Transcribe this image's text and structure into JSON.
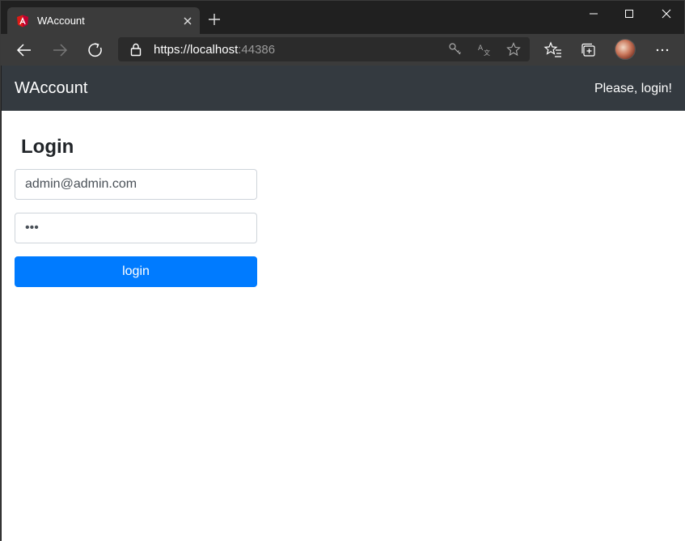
{
  "browser": {
    "tab": {
      "title": "WAccount",
      "favicon": "angular-logo-icon"
    },
    "address": {
      "scheme": "https://",
      "host": "localhost",
      "port": ":44386"
    }
  },
  "app": {
    "brand": "WAccount",
    "nav_message": "Please, login!"
  },
  "login": {
    "title": "Login",
    "email_value": "admin@admin.com",
    "password_value": "abc",
    "button_label": "login"
  },
  "colors": {
    "navbar": "#343a40",
    "primary": "#007bff",
    "browser_frame": "#202020",
    "toolbar": "#3b3b3b"
  }
}
